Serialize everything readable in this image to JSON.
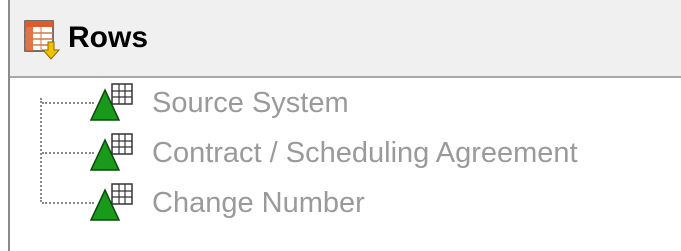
{
  "header": {
    "title": "Rows",
    "icon": "rows-table-icon"
  },
  "tree": {
    "items": [
      {
        "label": "Source System",
        "icon": "level-hierarchy-icon"
      },
      {
        "label": "Contract / Scheduling Agreement",
        "icon": "level-hierarchy-icon"
      },
      {
        "label": "Change Number",
        "icon": "level-hierarchy-icon"
      }
    ]
  },
  "colors": {
    "header_bg": "#f0f0f0",
    "item_text": "#9a9a9a",
    "triangle_green": "#1a9a1a"
  }
}
